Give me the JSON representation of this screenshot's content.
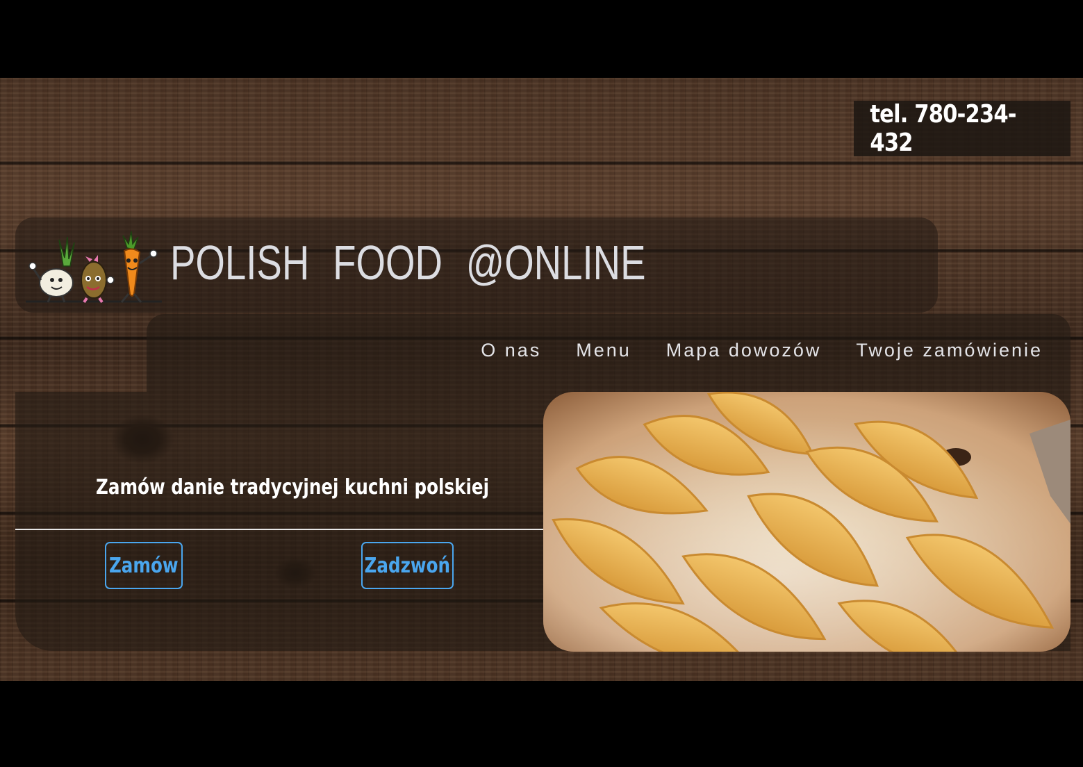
{
  "phone": {
    "text": "tel. 780-234-432"
  },
  "header": {
    "title": "POLISH  FOOD  @ONLINE",
    "logo_icon": "vegetables-mascots-logo"
  },
  "nav": {
    "items": [
      "O nas",
      "Menu",
      "Mapa dowozów",
      "Twoje zamówienie"
    ]
  },
  "hero": {
    "tagline": "Zamów danie tradycyjnej kuchni polskiej",
    "order_button": "Zamów",
    "call_button": "Zadzwoń",
    "photo_icon": "pierogi-photo"
  },
  "colors": {
    "accent": "#4aa6ee",
    "background": "#000000",
    "wood": "#4a3223",
    "panel": "#231a14"
  }
}
